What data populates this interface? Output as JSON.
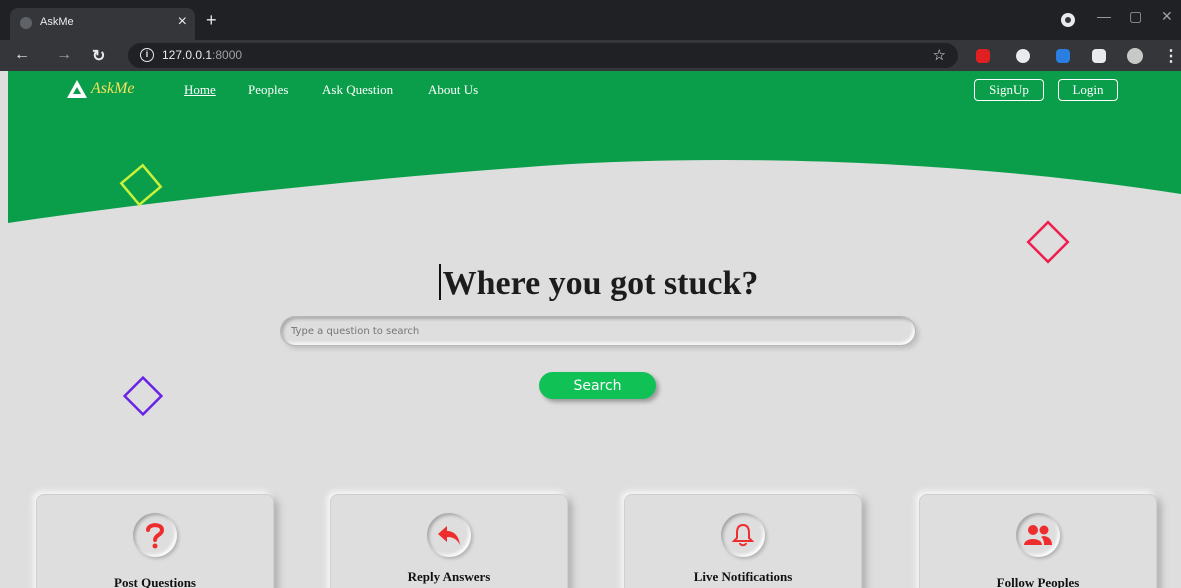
{
  "browser": {
    "tab_title": "AskMe",
    "tab_close": "×",
    "new_tab": "+",
    "url_host": "127.0.0.1",
    "url_port": ":8000",
    "info_glyph": "i"
  },
  "navbar": {
    "logo_text": "AskMe",
    "links": [
      "Home",
      "Peoples",
      "Ask Question",
      "About Us"
    ],
    "signup_label": "SignUp",
    "login_label": "Login"
  },
  "hero": {
    "headline": "Where you got stuck?",
    "search_placeholder": "Type a question to search",
    "search_button": "Search"
  },
  "features": [
    {
      "label": "Post Questions",
      "icon": "question-icon"
    },
    {
      "label": "Reply Answers",
      "icon": "reply-icon"
    },
    {
      "label": "Live Notifications",
      "icon": "bell-icon"
    },
    {
      "label": "Follow Peoples",
      "icon": "users-icon"
    }
  ],
  "colors": {
    "brand_green": "#0a9e4a",
    "accent_green": "#10c155",
    "icon_red": "#ee2e2e",
    "logo_yellow": "#f5e25a",
    "square_yellow": "#c9f23a",
    "square_red": "#ee1f4e",
    "square_purple": "#6a22e6"
  }
}
